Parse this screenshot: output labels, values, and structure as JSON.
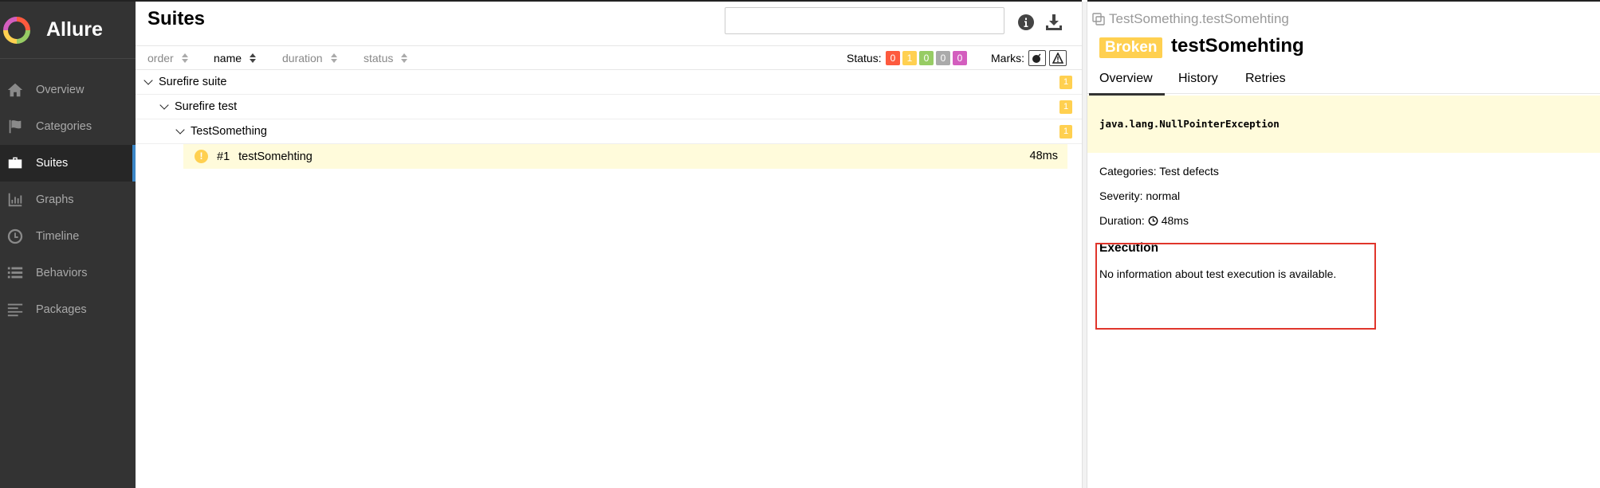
{
  "sidebar": {
    "brand": "Allure",
    "items": [
      {
        "label": "Overview",
        "icon": "home-icon",
        "active": false
      },
      {
        "label": "Categories",
        "icon": "flag-icon",
        "active": false
      },
      {
        "label": "Suites",
        "icon": "briefcase-icon",
        "active": true
      },
      {
        "label": "Graphs",
        "icon": "bar-chart-icon",
        "active": false
      },
      {
        "label": "Timeline",
        "icon": "clock-icon",
        "active": false
      },
      {
        "label": "Behaviors",
        "icon": "list-icon",
        "active": false
      },
      {
        "label": "Packages",
        "icon": "align-left-icon",
        "active": false
      }
    ]
  },
  "main": {
    "title": "Suites",
    "search": {
      "value": "",
      "placeholder": ""
    },
    "sort": {
      "order": "order",
      "name": "name",
      "duration": "duration",
      "status": "status",
      "active": "name"
    },
    "status_filter": {
      "label": "Status:",
      "counts": [
        {
          "status": "failed",
          "value": "0",
          "color": "#fd5a3e"
        },
        {
          "status": "broken",
          "value": "1",
          "color": "#ffd050"
        },
        {
          "status": "passed",
          "value": "0",
          "color": "#97cc64"
        },
        {
          "status": "skipped",
          "value": "0",
          "color": "#aaaaaa"
        },
        {
          "status": "unknown",
          "value": "0",
          "color": "#d35ebe"
        }
      ]
    },
    "marks": {
      "label": "Marks:",
      "icons": [
        "bomb-icon",
        "warning-icon"
      ]
    },
    "tree": [
      {
        "label": "Surefire suite",
        "count": "1",
        "depth": 0
      },
      {
        "label": "Surefire test",
        "count": "1",
        "depth": 1
      },
      {
        "label": "TestSomething",
        "count": "1",
        "depth": 2
      }
    ],
    "test_case": {
      "number": "#1",
      "name": "testSomehting",
      "duration": "48ms",
      "status": "broken"
    }
  },
  "detail": {
    "breadcrumb": "TestSomething.testSomehting",
    "status": "Broken",
    "title": "testSomehting",
    "tabs": [
      "Overview",
      "History",
      "Retries"
    ],
    "active_tab": "Overview",
    "error": "java.lang.NullPointerException",
    "categories": "Categories: Test defects",
    "severity": "Severity: normal",
    "duration_label": "Duration:",
    "duration_value": "48ms",
    "execution_title": "Execution",
    "execution_text": "No information about test execution is available."
  },
  "colors": {
    "sidebar_bg": "#333333",
    "accent": "#3b86c6",
    "broken": "#ffd050",
    "highlight_box": "#e0352b"
  }
}
